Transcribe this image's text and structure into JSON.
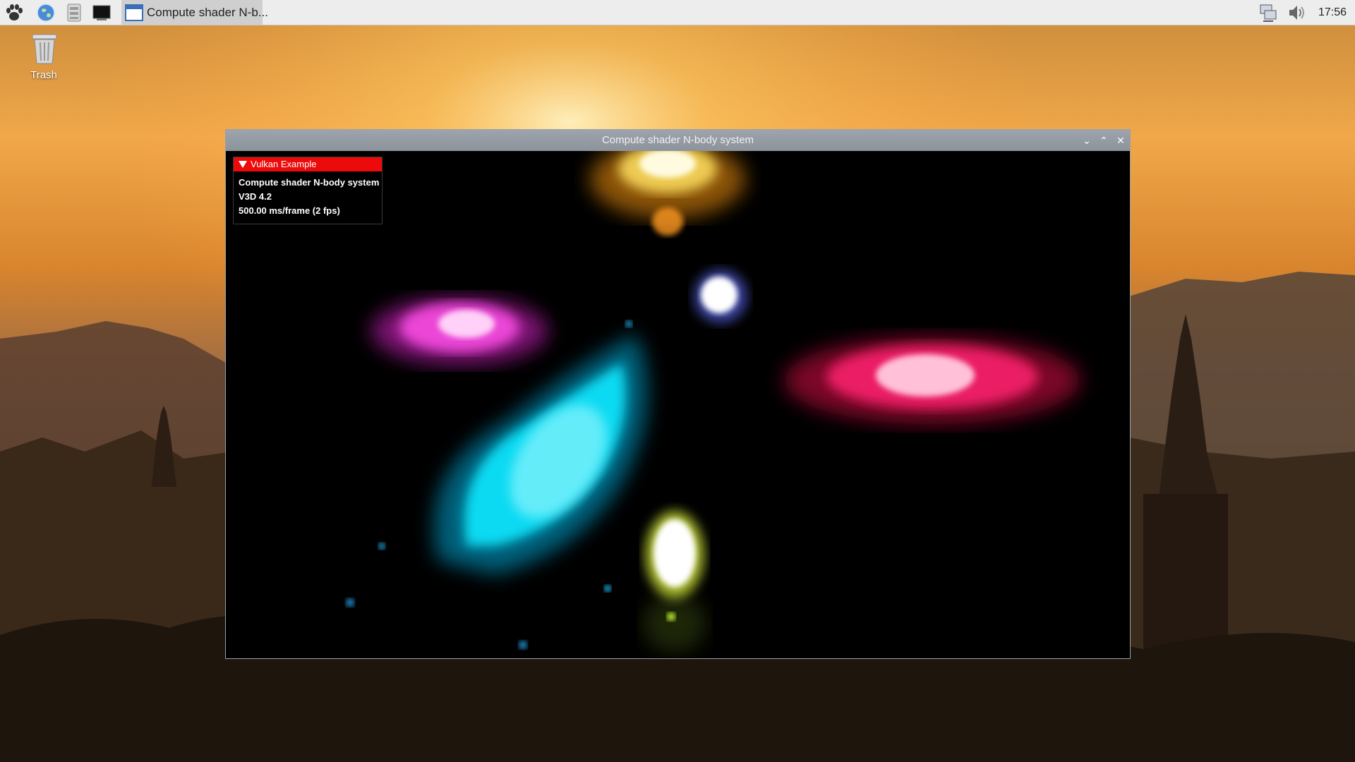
{
  "taskbar": {
    "launchers": [
      {
        "icon": "menu-paw-icon"
      },
      {
        "icon": "web-browser-icon"
      },
      {
        "icon": "file-manager-icon"
      },
      {
        "icon": "terminal-icon"
      }
    ],
    "active_task": {
      "icon": "window-app-icon",
      "label": "Compute shader N-b..."
    },
    "tray": [
      {
        "icon": "network-icon"
      },
      {
        "icon": "volume-icon"
      }
    ],
    "clock": "17:56"
  },
  "desktop": {
    "trash_label": "Trash"
  },
  "window": {
    "title": "Compute shader N-body system",
    "controls": {
      "minimize": "⌄",
      "maximize": "⌃",
      "close": "✕"
    }
  },
  "overlay": {
    "header": "Vulkan Example",
    "line1": "Compute shader N-body system",
    "line2": "V3D 4.2",
    "line3": "500.00 ms/frame (2 fps)"
  },
  "colors": {
    "overlay_header": "#ec0a0a",
    "titlebar": "#9ea4ad",
    "particles": [
      "#ffb020",
      "#ff40e0",
      "#00e5ff",
      "#ff1a6a",
      "#ffffff",
      "#f8ff60"
    ]
  }
}
